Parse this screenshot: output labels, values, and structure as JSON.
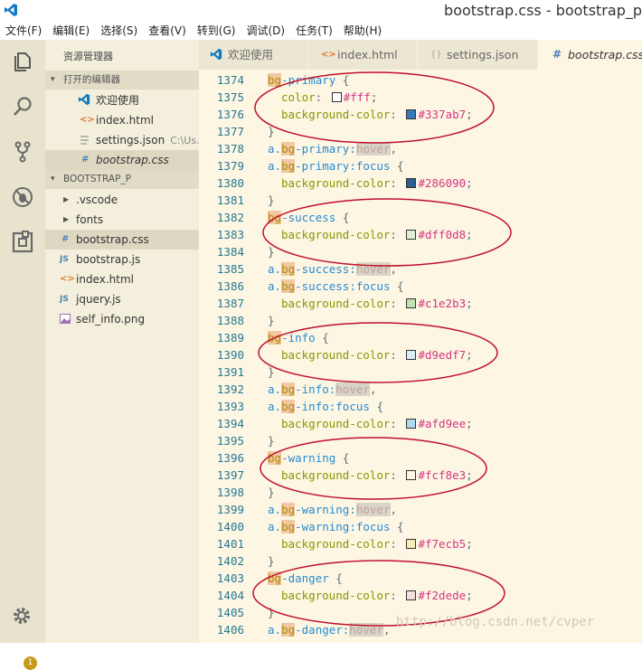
{
  "window": {
    "title": "bootstrap.css - bootstrap_p"
  },
  "menu": [
    "文件(F)",
    "编辑(E)",
    "选择(S)",
    "查看(V)",
    "转到(G)",
    "调试(D)",
    "任务(T)",
    "帮助(H)"
  ],
  "sidebar": {
    "title": "资源管理器",
    "open_editors_header": "打开的编辑器",
    "open_editors": [
      {
        "label": "欢迎使用",
        "icon": "vscode-icon"
      },
      {
        "label": "index.html",
        "icon": "html-icon"
      },
      {
        "label": "settings.json",
        "description": "C:\\Us...",
        "icon": "json-icon"
      },
      {
        "label": "bootstrap.css",
        "icon": "css-icon"
      }
    ],
    "project_header": "BOOTSTRAP_P",
    "files": [
      {
        "label": ".vscode",
        "icon": "chevron-right-icon"
      },
      {
        "label": "fonts",
        "icon": "chevron-right-icon"
      },
      {
        "label": "bootstrap.css",
        "icon": "css-icon",
        "icon_text": "#"
      },
      {
        "label": "bootstrap.js",
        "icon": "js-icon",
        "icon_text": "JS"
      },
      {
        "label": "index.html",
        "icon": "html-icon",
        "icon_text": "<>"
      },
      {
        "label": "jquery.js",
        "icon": "js-icon",
        "icon_text": "JS"
      },
      {
        "label": "self_info.png",
        "icon": "image-icon"
      }
    ]
  },
  "activity": {
    "badge": "1"
  },
  "tabs": [
    {
      "label": "欢迎使用",
      "icon": "vscode-icon"
    },
    {
      "label": "index.html",
      "icon": "html-icon",
      "icon_text": "<>"
    },
    {
      "label": "settings.json",
      "icon": "json-icon",
      "icon_text": "{}"
    },
    {
      "label": "bootstrap.css",
      "icon": "css-icon",
      "icon_text": "#"
    }
  ],
  "code": [
    {
      "ln": "1374",
      "kind": "sel",
      "pre": "",
      "cls": "bg",
      "name": "-primary",
      "tail": " {"
    },
    {
      "ln": "1375",
      "kind": "decl",
      "prop": "color",
      "color": "#fff",
      "value": "#fff"
    },
    {
      "ln": "1376",
      "kind": "decl",
      "prop": "background-color",
      "color": "#337ab7",
      "value": "#337ab7"
    },
    {
      "ln": "1377",
      "kind": "close"
    },
    {
      "ln": "1378",
      "kind": "sel",
      "pre": "a.",
      "cls": "bg",
      "name": "-primary:",
      "hover": "hover",
      "tail": ","
    },
    {
      "ln": "1379",
      "kind": "sel",
      "pre": "a.",
      "cls": "bg",
      "name": "-primary:focus",
      "tail": " {"
    },
    {
      "ln": "1380",
      "kind": "decl",
      "prop": "background-color",
      "color": "#286090",
      "value": "#286090"
    },
    {
      "ln": "1381",
      "kind": "close"
    },
    {
      "ln": "1382",
      "kind": "sel",
      "pre": "",
      "cls": "bg",
      "name": "-success",
      "tail": " {"
    },
    {
      "ln": "1383",
      "kind": "decl",
      "prop": "background-color",
      "color": "#dff0d8",
      "value": "#dff0d8"
    },
    {
      "ln": "1384",
      "kind": "close"
    },
    {
      "ln": "1385",
      "kind": "sel",
      "pre": "a.",
      "cls": "bg",
      "name": "-success:",
      "hover": "hover",
      "tail": ","
    },
    {
      "ln": "1386",
      "kind": "sel",
      "pre": "a.",
      "cls": "bg",
      "name": "-success:focus",
      "tail": " {"
    },
    {
      "ln": "1387",
      "kind": "decl",
      "prop": "background-color",
      "color": "#c1e2b3",
      "value": "#c1e2b3"
    },
    {
      "ln": "1388",
      "kind": "close"
    },
    {
      "ln": "1389",
      "kind": "sel",
      "pre": "",
      "cls": "bg",
      "name": "-info",
      "tail": " {"
    },
    {
      "ln": "1390",
      "kind": "decl",
      "prop": "background-color",
      "color": "#d9edf7",
      "value": "#d9edf7"
    },
    {
      "ln": "1391",
      "kind": "close"
    },
    {
      "ln": "1392",
      "kind": "sel",
      "pre": "a.",
      "cls": "bg",
      "name": "-info:",
      "hover": "hover",
      "tail": ","
    },
    {
      "ln": "1393",
      "kind": "sel",
      "pre": "a.",
      "cls": "bg",
      "name": "-info:focus",
      "tail": " {"
    },
    {
      "ln": "1394",
      "kind": "decl",
      "prop": "background-color",
      "color": "#afd9ee",
      "value": "#afd9ee"
    },
    {
      "ln": "1395",
      "kind": "close"
    },
    {
      "ln": "1396",
      "kind": "sel",
      "pre": "",
      "cls": "bg",
      "name": "-warning",
      "tail": " {"
    },
    {
      "ln": "1397",
      "kind": "decl",
      "prop": "background-color",
      "color": "#fcf8e3",
      "value": "#fcf8e3"
    },
    {
      "ln": "1398",
      "kind": "close"
    },
    {
      "ln": "1399",
      "kind": "sel",
      "pre": "a.",
      "cls": "bg",
      "name": "-warning:",
      "hover": "hover",
      "tail": ","
    },
    {
      "ln": "1400",
      "kind": "sel",
      "pre": "a.",
      "cls": "bg",
      "name": "-warning:focus",
      "tail": " {"
    },
    {
      "ln": "1401",
      "kind": "decl",
      "prop": "background-color",
      "color": "#f7ecb5",
      "value": "#f7ecb5"
    },
    {
      "ln": "1402",
      "kind": "close"
    },
    {
      "ln": "1403",
      "kind": "sel",
      "pre": "",
      "cls": "bg",
      "name": "-danger",
      "tail": " {"
    },
    {
      "ln": "1404",
      "kind": "decl",
      "prop": "background-color",
      "color": "#f2dede",
      "value": "#f2dede"
    },
    {
      "ln": "1405",
      "kind": "close"
    },
    {
      "ln": "1406",
      "kind": "sel",
      "pre": "a.",
      "cls": "bg",
      "name": "-danger:",
      "hover": "hover",
      "tail": ","
    }
  ],
  "watermark": "http://blog.csdn.net/cvper",
  "colors": {
    "editor_bg": "#fdf6e3",
    "sidebar_bg": "#f3efdc",
    "annotation": "#c0102a"
  }
}
